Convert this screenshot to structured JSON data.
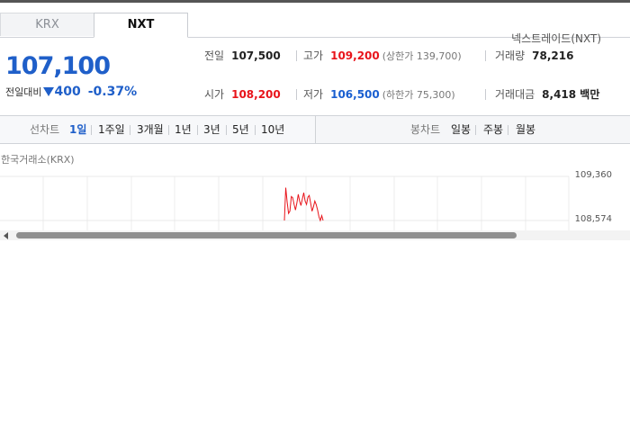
{
  "tabs": [
    {
      "label": "KRX",
      "active": false
    },
    {
      "label": "NXT",
      "active": true
    }
  ],
  "provider": "넥스트레이드(NXT)",
  "price": {
    "current": "107,100",
    "change_label": "전일대비",
    "change": "400",
    "change_pct": "-0.37%",
    "direction": "down"
  },
  "stats": {
    "prev_close": {
      "label": "전일",
      "value": "107,500"
    },
    "high": {
      "label": "고가",
      "value": "109,200",
      "sub": "(상한가 139,700)"
    },
    "volume": {
      "label": "거래량",
      "value": "78,216"
    },
    "open": {
      "label": "시가",
      "value": "108,200"
    },
    "low": {
      "label": "저가",
      "value": "106,500",
      "sub": "(하한가 75,300)"
    },
    "amount": {
      "label": "거래대금",
      "value": "8,418 백만"
    }
  },
  "toolbar": {
    "line_chart_label": "선차트",
    "periods": [
      "1일",
      "1주일",
      "3개월",
      "1년",
      "3년",
      "5년",
      "10년"
    ],
    "active_period": "1일",
    "candle_label": "봉차트",
    "candle_periods": [
      "일봉",
      "주봉",
      "월봉"
    ]
  },
  "chart": {
    "caption": "한국거래소(KRX)",
    "y_ticks": [
      "109,360",
      "108,574"
    ]
  },
  "colors": {
    "up": "#e8141b",
    "down": "#1f5fc9",
    "line": "#e8141b"
  },
  "chart_data": {
    "type": "line",
    "title": "",
    "xlabel": "",
    "ylabel": "",
    "ylim": [
      108574,
      109360
    ],
    "series": [
      {
        "values": [
          108574,
          109160,
          108900,
          108700,
          108740,
          109000,
          108980,
          108860,
          108760,
          108880,
          109040,
          108920,
          108840,
          108960,
          109070,
          108920,
          108860,
          108990,
          109020,
          108880,
          108740,
          108820,
          108920,
          108860,
          108760,
          108640,
          108574,
          108660,
          108574
        ]
      }
    ]
  }
}
